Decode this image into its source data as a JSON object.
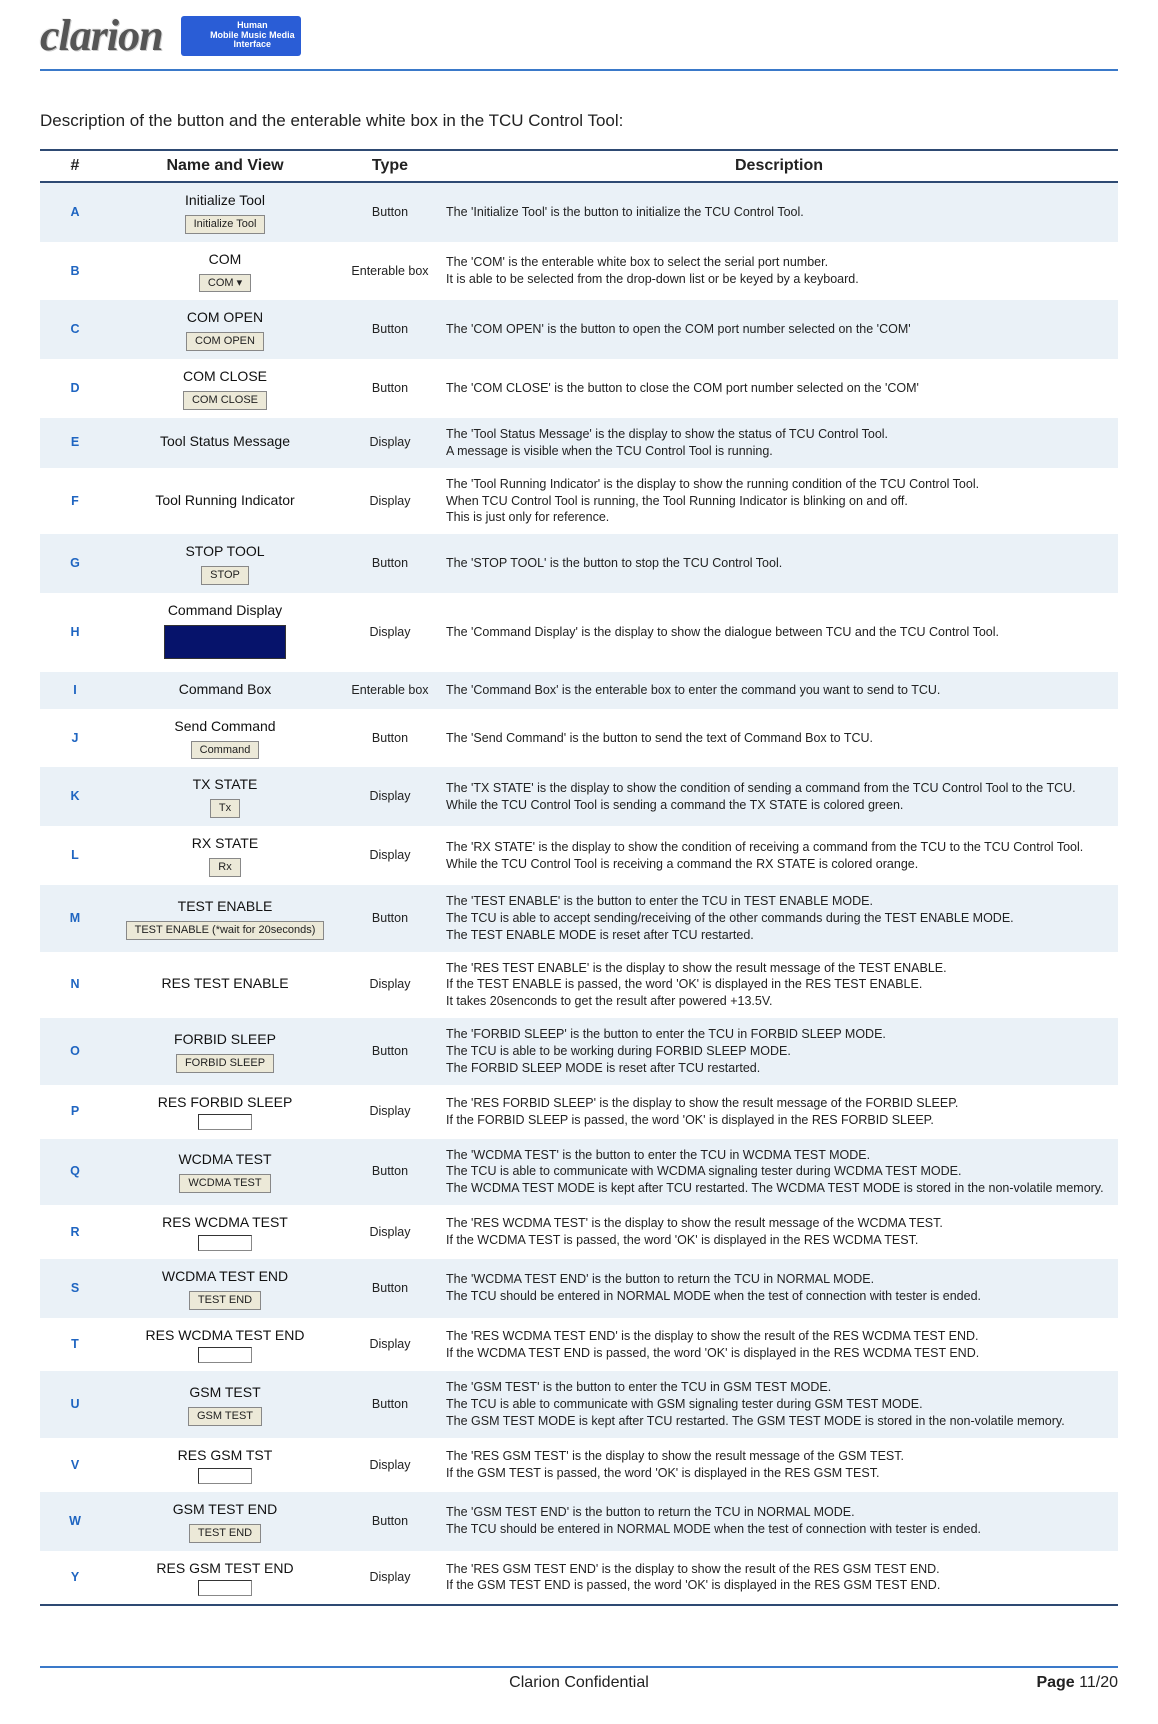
{
  "header": {
    "logo": "clarion",
    "badge_line1": "Human",
    "badge_line2": "Mobile Music Media",
    "badge_line3": "Interface"
  },
  "intro": "Description of the button and the enterable white box in the TCU Control Tool:",
  "table": {
    "headers": {
      "num": "#",
      "name": "Name and View",
      "type": "Type",
      "desc": "Description"
    },
    "rows": [
      {
        "id": "A",
        "name": "Initialize Tool",
        "btn": "Initialize Tool",
        "type": "Button",
        "desc": "The 'Initialize Tool' is the button to initialize the TCU Control Tool."
      },
      {
        "id": "B",
        "name": "COM",
        "btn": "COM ▾",
        "type": "Enterable box",
        "desc": "The 'COM' is the enterable white box to select the serial port number.\nIt is able to be selected from the drop-down list or be keyed by a keyboard."
      },
      {
        "id": "C",
        "name": "COM OPEN",
        "btn": "COM OPEN",
        "type": "Button",
        "desc": "The 'COM OPEN' is the button to open the COM port number selected on the 'COM'"
      },
      {
        "id": "D",
        "name": "COM CLOSE",
        "btn": "COM CLOSE",
        "type": "Button",
        "desc": "The 'COM CLOSE' is the button to close the COM port number selected on the 'COM'"
      },
      {
        "id": "E",
        "name": "Tool Status Message",
        "btn": "",
        "type": "Display",
        "desc": "The 'Tool Status Message' is the display to show the status of TCU Control Tool.\nA message is visible when the TCU Control Tool is running."
      },
      {
        "id": "F",
        "name": "Tool Running Indicator",
        "btn": "",
        "type": "Display",
        "desc": "The 'Tool Running Indicator' is the display to show the running condition of the TCU Control Tool.\nWhen TCU Control Tool is running, the Tool Running Indicator is blinking on and off.\nThis is just only for reference."
      },
      {
        "id": "G",
        "name": "STOP TOOL",
        "btn": "STOP",
        "type": "Button",
        "desc": "The 'STOP TOOL' is the button to stop the TCU Control Tool."
      },
      {
        "id": "H",
        "name": "Command Display",
        "btn": "__dark__",
        "type": "Display",
        "desc": "The 'Command Display' is the display to show the dialogue between TCU and the TCU Control Tool."
      },
      {
        "id": "I",
        "name": "Command Box",
        "btn": "",
        "type": "Enterable box",
        "desc": "The 'Command Box' is the enterable box to enter the command you want to send to TCU."
      },
      {
        "id": "J",
        "name": "Send Command",
        "btn": "Command",
        "type": "Button",
        "desc": "The 'Send Command' is the button to send the text of Command Box to TCU."
      },
      {
        "id": "K",
        "name": "TX STATE",
        "btn": "Tx",
        "type": "Display",
        "desc": "The 'TX STATE' is the display to show the condition of sending a command from the TCU Control Tool to the TCU.\nWhile the TCU Control Tool is sending a command the TX STATE is colored green."
      },
      {
        "id": "L",
        "name": "RX STATE",
        "btn": "Rx",
        "type": "Display",
        "desc": "The 'RX STATE' is the display to show the condition of receiving a command from the TCU to the TCU Control Tool.\nWhile the TCU Control Tool is receiving a command the RX STATE is colored orange."
      },
      {
        "id": "M",
        "name": "TEST ENABLE",
        "btn": "TEST ENABLE (*wait for 20seconds)",
        "type": "Button",
        "desc": "The 'TEST ENABLE' is the button to enter the TCU in TEST ENABLE MODE.\nThe TCU is able to accept sending/receiving of the other commands during the TEST ENABLE MODE.\n The TEST ENABLE MODE is reset after TCU restarted."
      },
      {
        "id": "N",
        "name": "RES TEST ENABLE",
        "btn": "",
        "type": "Display",
        "desc": "The 'RES TEST ENABLE' is the display to show the result message of the TEST ENABLE.\nIf the TEST ENABLE is passed, the word 'OK' is displayed in the RES TEST ENABLE.\nIt takes 20senconds to get the result after powered +13.5V."
      },
      {
        "id": "O",
        "name": "FORBID SLEEP",
        "btn": "FORBID SLEEP",
        "type": "Button",
        "desc": "The 'FORBID SLEEP' is the button to enter the TCU in FORBID SLEEP MODE.\nThe TCU is able to be working during FORBID SLEEP MODE.\nThe FORBID SLEEP MODE is reset after TCU restarted."
      },
      {
        "id": "P",
        "name": "RES FORBID SLEEP",
        "btn": "__sunken__",
        "type": "Display",
        "desc": "The 'RES FORBID SLEEP' is the display to show the result message of the FORBID SLEEP.\nIf the FORBID SLEEP is passed, the word 'OK' is displayed in the RES FORBID SLEEP."
      },
      {
        "id": "Q",
        "name": "WCDMA TEST",
        "btn": "WCDMA TEST",
        "type": "Button",
        "desc": "The 'WCDMA TEST' is the button to enter the TCU in WCDMA TEST MODE.\nThe TCU is able to communicate with WCDMA signaling tester during WCDMA TEST MODE.\nThe WCDMA TEST MODE is kept after TCU restarted. The WCDMA TEST MODE is stored in the non-volatile memory."
      },
      {
        "id": "R",
        "name": "RES WCDMA TEST",
        "btn": "__sunken__",
        "type": "Display",
        "desc": "The 'RES WCDMA TEST' is the display to show the result message of the WCDMA TEST.\nIf the WCDMA TEST is passed, the word 'OK' is displayed in the RES WCDMA TEST."
      },
      {
        "id": "S",
        "name": "WCDMA TEST END",
        "btn": "TEST END",
        "type": "Button",
        "desc": "The 'WCDMA TEST END' is the button to return the TCU in NORMAL MODE.\nThe TCU should be entered in NORMAL MODE when the test of connection with tester is ended."
      },
      {
        "id": "T",
        "name": "RES WCDMA TEST END",
        "btn": "__sunken__",
        "type": "Display",
        "desc": "The 'RES WCDMA TEST END' is the display to show the result of the RES WCDMA TEST END.\nIf the WCDMA TEST END is passed, the word 'OK' is displayed in the RES WCDMA TEST END."
      },
      {
        "id": "U",
        "name": "GSM TEST",
        "btn": "GSM TEST",
        "type": "Button",
        "desc": "The 'GSM TEST' is the button to enter the TCU in GSM TEST MODE.\nThe TCU is able to communicate with GSM signaling tester during GSM TEST MODE.\nThe GSM TEST MODE is kept after TCU restarted. The GSM TEST MODE is stored in the non-volatile memory."
      },
      {
        "id": "V",
        "name": "RES GSM TST",
        "btn": "__sunken__",
        "type": "Display",
        "desc": "The 'RES GSM TEST' is the display to show the result message of the GSM TEST.\nIf the GSM TEST is passed, the word 'OK' is displayed in the RES GSM TEST."
      },
      {
        "id": "W",
        "name": "GSM TEST END",
        "btn": "TEST END",
        "type": "Button",
        "desc": "The 'GSM TEST END' is the button to return the TCU in NORMAL MODE.\nThe TCU should be entered in NORMAL MODE when the test of connection with tester is ended."
      },
      {
        "id": "Y",
        "name": "RES GSM TEST END",
        "btn": "__sunken__",
        "type": "Display",
        "desc": "The 'RES GSM TEST END' is the display to show the result of the RES GSM TEST END.\nIf the GSM TEST END is passed, the word 'OK' is displayed in the RES GSM TEST END."
      }
    ]
  },
  "footer": {
    "center": "Clarion Confidential",
    "page_label": "Page ",
    "page": "11/20"
  }
}
